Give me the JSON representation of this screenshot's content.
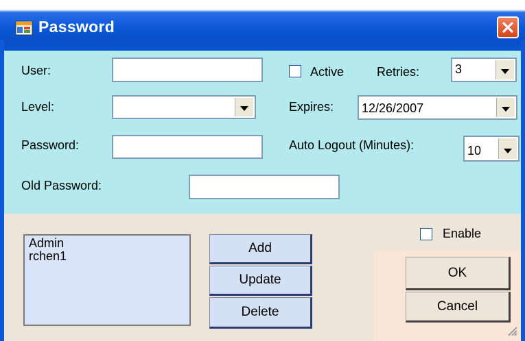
{
  "window": {
    "title": "Password"
  },
  "form": {
    "user_label": "User:",
    "user_value": "",
    "level_label": "Level:",
    "level_value": "",
    "password_label": "Password:",
    "password_value": "",
    "old_password_label": "Old Password:",
    "old_password_value": "",
    "active_label": "Active",
    "active_checked": false,
    "retries_label": "Retries:",
    "retries_value": "3",
    "expires_label": "Expires:",
    "expires_value": "12/26/2007",
    "auto_logout_label": "Auto Logout (Minutes):",
    "auto_logout_value": "10"
  },
  "users_list": [
    "Admin",
    "rchen1"
  ],
  "buttons": {
    "add": "Add",
    "update": "Update",
    "delete": "Delete",
    "ok": "OK",
    "cancel": "Cancel"
  },
  "enable": {
    "label": "Enable",
    "checked": false
  },
  "colors": {
    "titlebar": "#0b58d8",
    "form_bg": "#b4eaed",
    "lower_bg": "#ede5d9",
    "list_bg": "#d9e4f8",
    "action_btn": "#d4e1f4"
  },
  "icons": {
    "app": "app-window-icon",
    "close": "close-icon",
    "dropdown": "chevron-down-icon",
    "grip": "resize-grip-icon"
  }
}
